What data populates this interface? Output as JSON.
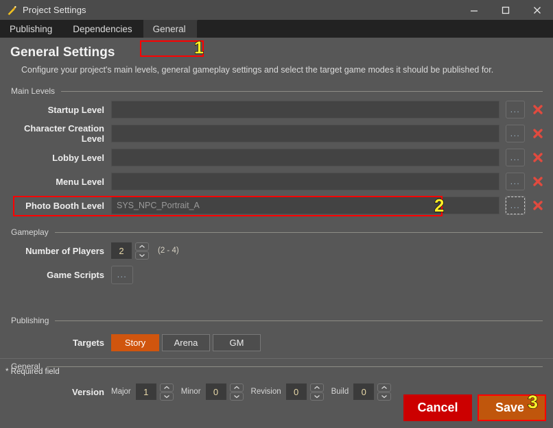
{
  "window": {
    "title": "Project Settings",
    "icon": "wand-icon",
    "controls": {
      "minimize": "minimize-icon",
      "maximize": "maximize-icon",
      "close": "close-icon"
    }
  },
  "tabs": [
    {
      "label": "Publishing",
      "active": false
    },
    {
      "label": "Dependencies",
      "active": false
    },
    {
      "label": "General",
      "active": true
    }
  ],
  "page": {
    "title": "General Settings",
    "subtitle": "Configure your project's main levels, general gameplay settings and select the target game modes it should be published for."
  },
  "sections": {
    "main_levels": {
      "label": "Main Levels",
      "rows": [
        {
          "label": "Startup Level",
          "value": "",
          "browse": "...",
          "clear": "x",
          "highlighted": false,
          "focused": false
        },
        {
          "label": "Character Creation Level",
          "value": "",
          "browse": "...",
          "clear": "x",
          "highlighted": false,
          "focused": false
        },
        {
          "label": "Lobby Level",
          "value": "",
          "browse": "...",
          "clear": "x",
          "highlighted": false,
          "focused": false
        },
        {
          "label": "Menu Level",
          "value": "",
          "browse": "...",
          "clear": "x",
          "highlighted": false,
          "focused": false
        },
        {
          "label": "Photo Booth Level",
          "value": "SYS_NPC_Portrait_A",
          "browse": "...",
          "clear": "x",
          "highlighted": true,
          "focused": true
        }
      ]
    },
    "gameplay": {
      "label": "Gameplay",
      "number_of_players": {
        "label": "Number of Players",
        "value": "2",
        "hint": "(2 - 4)"
      },
      "game_scripts": {
        "label": "Game Scripts",
        "browse": "..."
      }
    },
    "publishing": {
      "label": "Publishing",
      "targets": {
        "label": "Targets",
        "options": [
          {
            "label": "Story",
            "selected": true
          },
          {
            "label": "Arena",
            "selected": false
          },
          {
            "label": "GM",
            "selected": false
          }
        ]
      }
    },
    "general": {
      "label": "General",
      "version": {
        "label": "Version",
        "fields": [
          {
            "label": "Major",
            "value": "1"
          },
          {
            "label": "Minor",
            "value": "0"
          },
          {
            "label": "Revision",
            "value": "0"
          },
          {
            "label": "Build",
            "value": "0"
          }
        ]
      }
    }
  },
  "footer": {
    "required_note": "* Required field",
    "cancel_label": "Cancel",
    "save_label": "Save"
  },
  "markers": [
    {
      "number": "1"
    },
    {
      "number": "2"
    },
    {
      "number": "3"
    }
  ],
  "colors": {
    "accent_orange": "#d0550e",
    "danger_red": "#cc0000",
    "highlight_red": "#ff0000",
    "marker_yellow": "#ffef28",
    "window_bg": "#575757",
    "tabbar_bg": "#222222",
    "input_bg": "#434343"
  }
}
